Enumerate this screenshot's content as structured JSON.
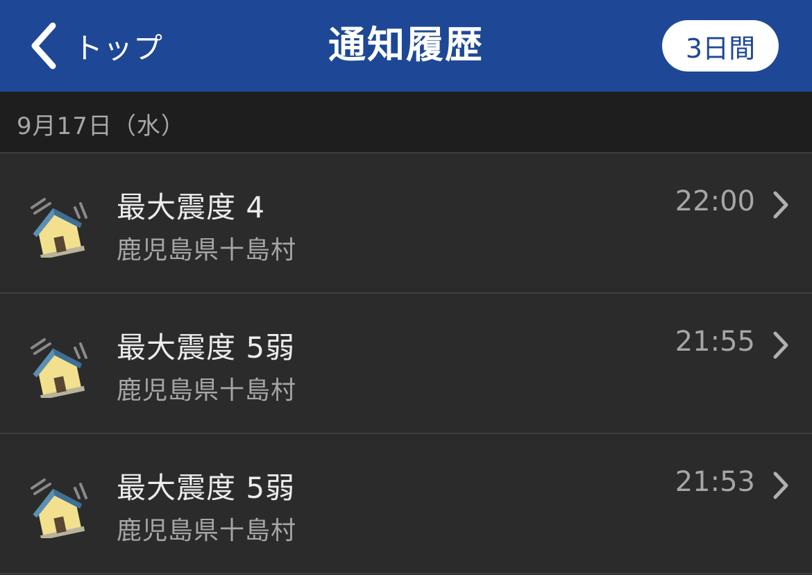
{
  "nav": {
    "back_label": "トップ",
    "title": "通知履歴",
    "range_label": "3日間"
  },
  "section": {
    "date": "9月17日（水）"
  },
  "items": [
    {
      "title": "最大震度 4",
      "location": "鹿児島県十島村",
      "time": "22:00",
      "icon": "earthquake-house-icon"
    },
    {
      "title": "最大震度 5弱",
      "location": "鹿児島県十島村",
      "time": "21:55",
      "icon": "earthquake-house-icon"
    },
    {
      "title": "最大震度 5弱",
      "location": "鹿児島県十島村",
      "time": "21:53",
      "icon": "earthquake-house-icon"
    }
  ],
  "colors": {
    "nav_bg": "#1e4896",
    "page_bg": "#2b2b2b",
    "section_bg": "#1e1e1e"
  }
}
